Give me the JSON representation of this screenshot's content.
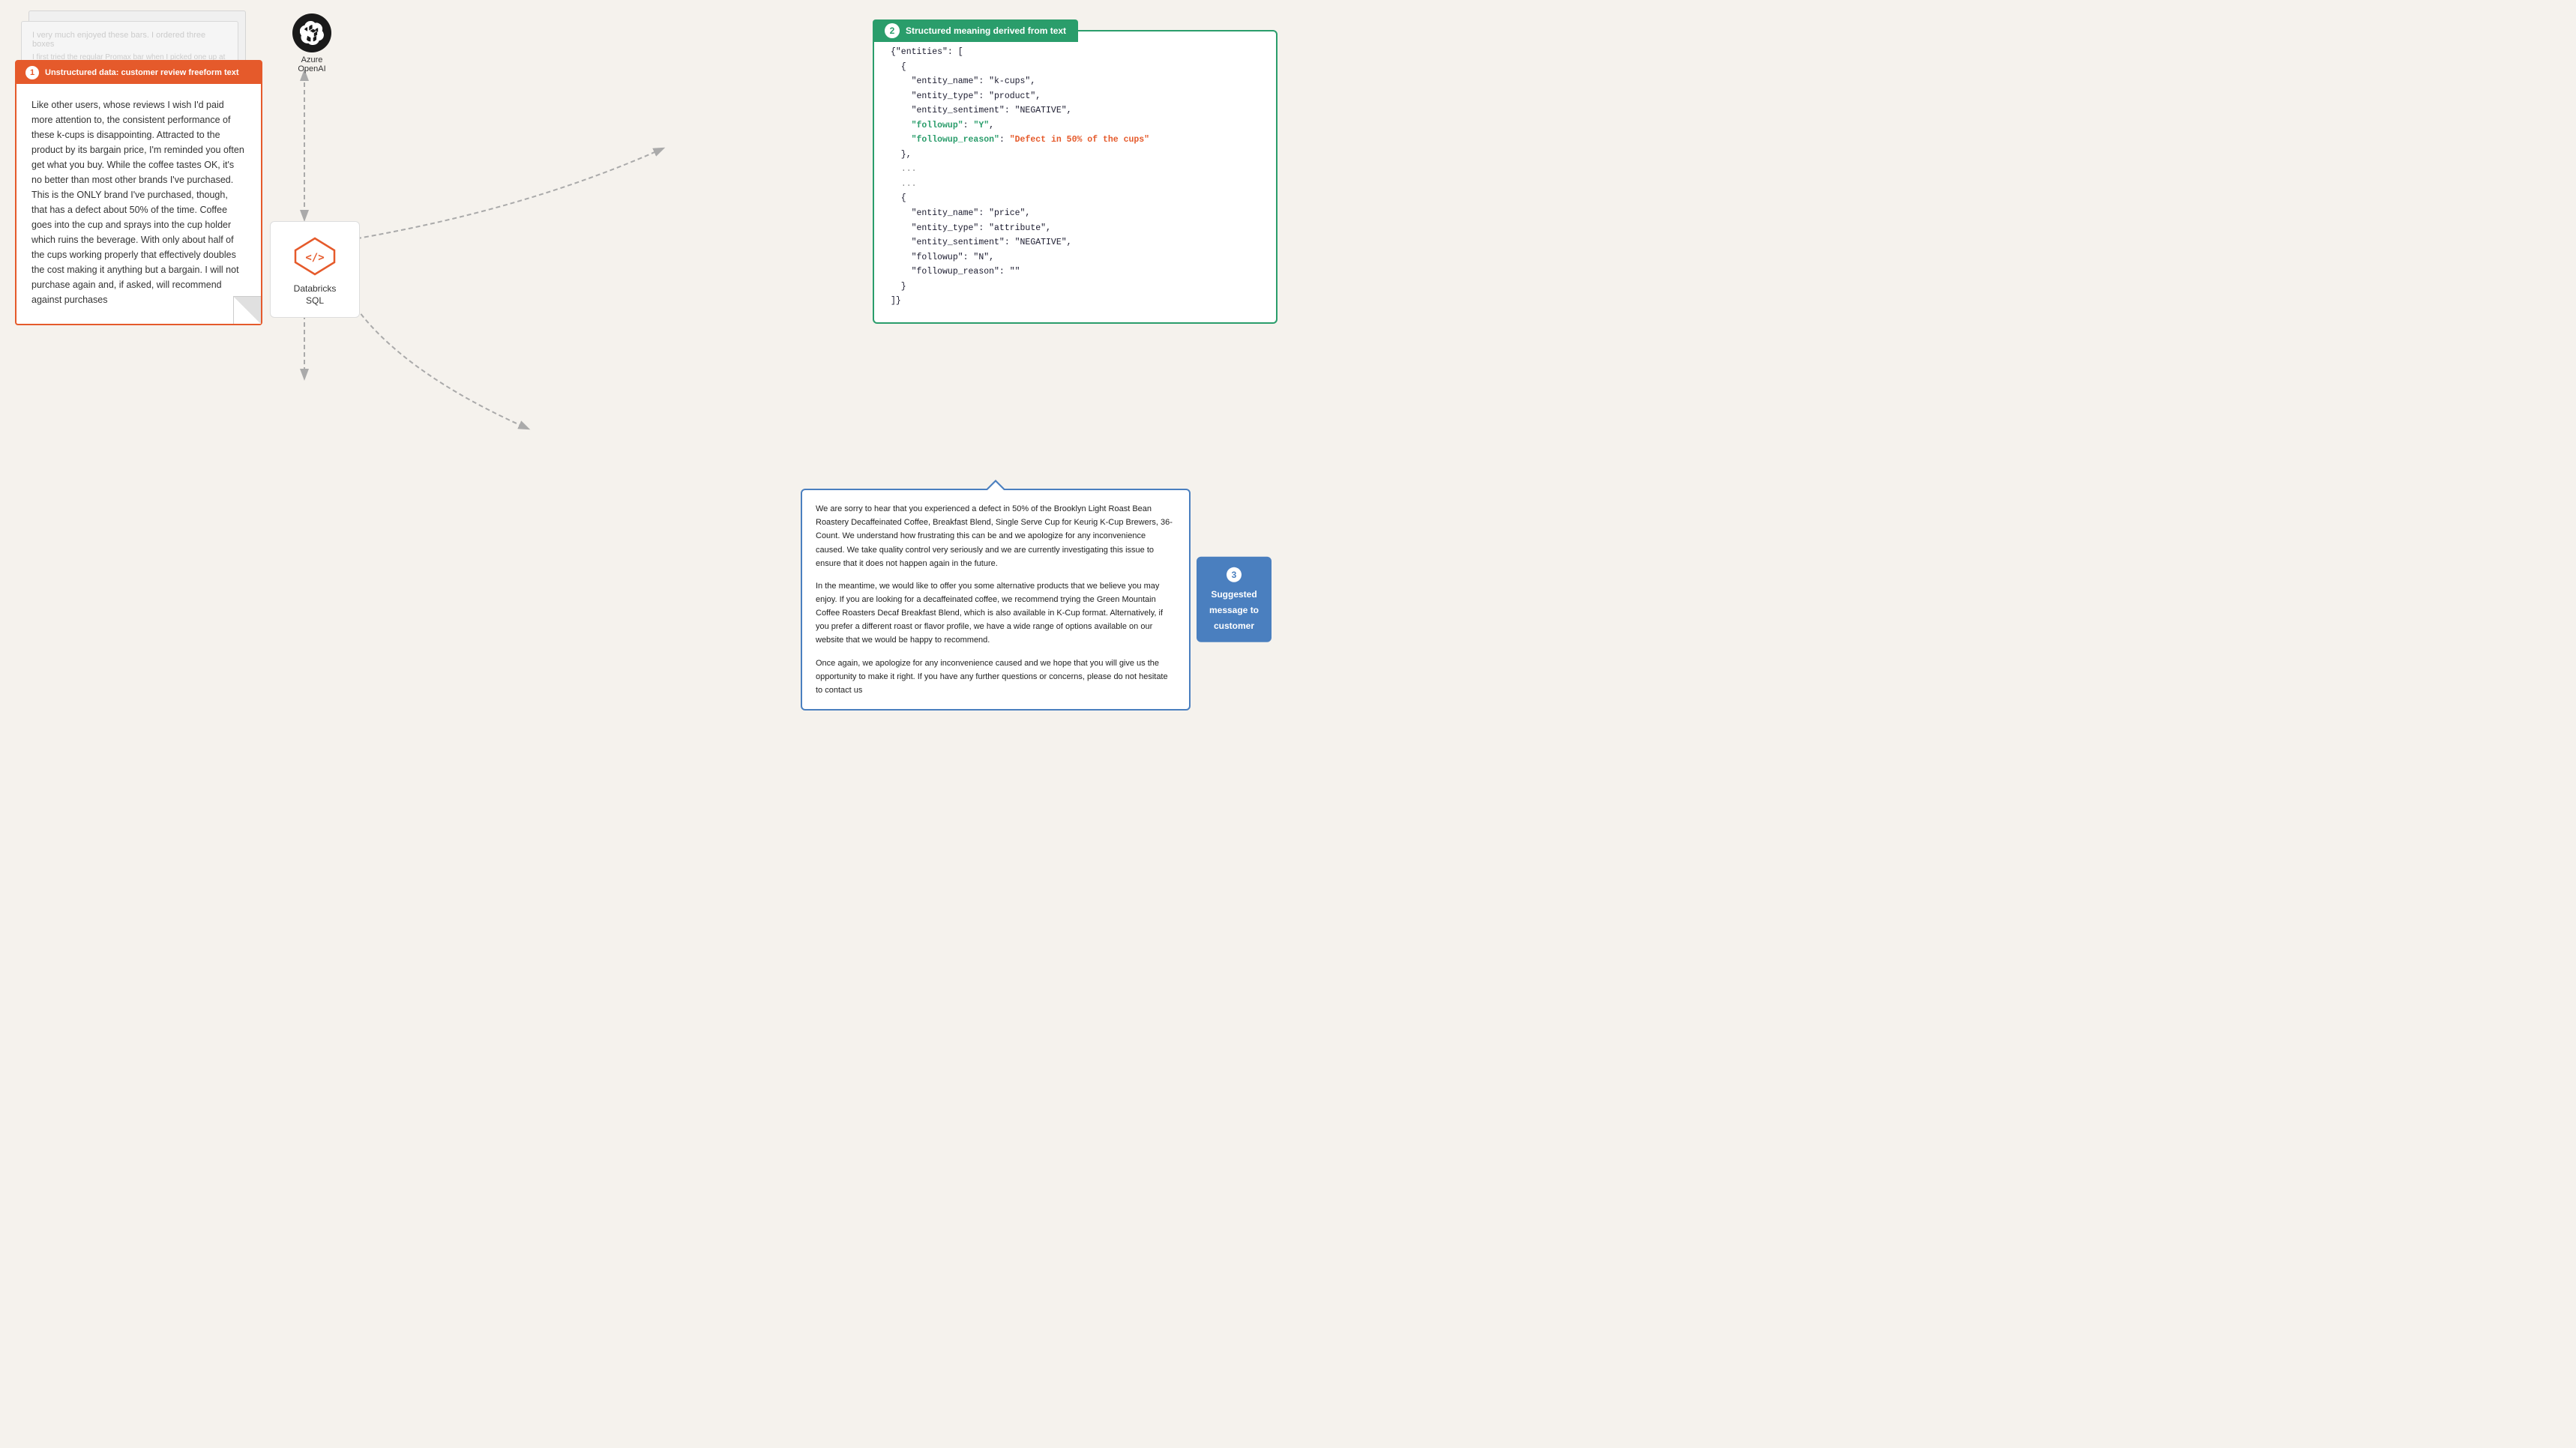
{
  "background_cards": {
    "card1_text": "I very much enjoyed these bars. I ordered three boxes",
    "card2_text": "I very much enjoyed these bars. I ordered three boxes",
    "card3_text": "I first tried the regular Promax bar when I picked one up at a Trader Joes. I needed to have som..."
  },
  "review_card": {
    "badge": "1",
    "label": "Unstructured data: customer review freeform text",
    "body": "Like other users, whose reviews I wish I'd paid more attention to, the consistent performance of these k-cups is disappointing. Attracted to the product by its bargain price, I'm reminded you often get what you buy. While the coffee tastes OK, it's no better than most other brands I've purchased. This is the ONLY brand I've purchased, though, that has a defect about 50% of the time. Coffee goes into the cup and sprays into the cup holder which ruins the beverage. With only about half of the cups working properly that effectively doubles the cost making it anything but a bargain. I will not purchase again and, if asked, will recommend against purchases"
  },
  "azure_openai": {
    "label_line1": "Azure",
    "label_line2": "OpenAI"
  },
  "databricks": {
    "label_line1": "Databricks",
    "label_line2": "SQL"
  },
  "json_box": {
    "badge": "2",
    "label": "Structured meaning derived from text",
    "content": {
      "line1": "{\"entities\": [",
      "block1": {
        "entity_name": "\"k-cups\"",
        "entity_type": "\"product\"",
        "entity_sentiment": "\"NEGATIVE\"",
        "followup_key": "\"followup\"",
        "followup_val": "\"Y\"",
        "followup_reason_key": "\"followup_reason\"",
        "followup_reason_val": "\"Defect in 50% of the cups\""
      },
      "dots": "...",
      "block2": {
        "entity_name": "\"price\"",
        "entity_type": "\"attribute\"",
        "entity_sentiment": "\"NEGATIVE\"",
        "followup": "\"N\"",
        "followup_reason": "\"\""
      },
      "closing": "}]}"
    }
  },
  "message_box": {
    "badge": "3",
    "label_line1": "Suggested",
    "label_line2": "message to",
    "label_line3": "customer",
    "para1": "We are sorry to hear that you experienced a defect in 50% of the Brooklyn Light Roast Bean Roastery Decaffeinated Coffee, Breakfast Blend, Single Serve Cup for Keurig K-Cup Brewers, 36-Count. We understand how frustrating this can be and we apologize for any inconvenience caused. We take quality control very seriously and we are currently investigating this issue to ensure that it does not happen again in the future.",
    "para2": "In the meantime, we would like to offer you some alternative products that we believe you may enjoy. If you are looking for a decaffeinated coffee, we recommend trying the Green Mountain Coffee Roasters Decaf Breakfast Blend, which is also available in K-Cup format. Alternatively, if you prefer a different roast or flavor profile, we have a wide range of options available on our website that we would be happy to recommend.",
    "para3": "Once again, we apologize for any inconvenience caused and we hope that you will give us the opportunity to make it right. If you have any further questions or concerns, please do not hesitate to contact us"
  },
  "colors": {
    "orange": "#e55a2b",
    "green": "#2a9d6b",
    "blue": "#4a7fbf",
    "background": "#f5f2ed"
  }
}
